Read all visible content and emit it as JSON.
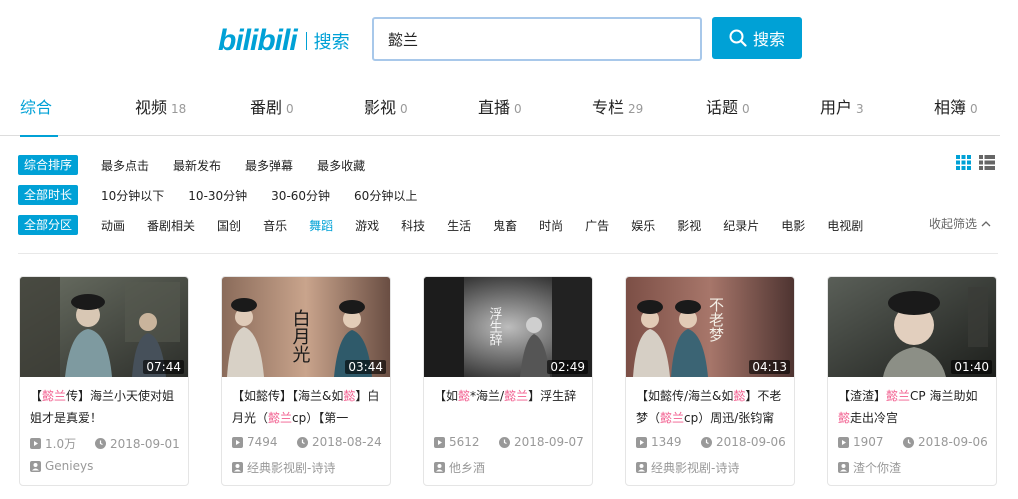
{
  "header": {
    "logo": "bilibili",
    "logo_sub": "搜索",
    "search_value": "懿兰",
    "search_button": "搜索"
  },
  "tabs": [
    {
      "label": "综合",
      "count": ""
    },
    {
      "label": "视频",
      "count": "18"
    },
    {
      "label": "番剧",
      "count": "0"
    },
    {
      "label": "影视",
      "count": "0"
    },
    {
      "label": "直播",
      "count": "0"
    },
    {
      "label": "专栏",
      "count": "29"
    },
    {
      "label": "话题",
      "count": "0"
    },
    {
      "label": "用户",
      "count": "3"
    },
    {
      "label": "相簿",
      "count": "0"
    }
  ],
  "filters": {
    "order": {
      "label": "综合排序",
      "items": [
        "最多点击",
        "最新发布",
        "最多弹幕",
        "最多收藏"
      ]
    },
    "duration": {
      "label": "全部时长",
      "items": [
        "10分钟以下",
        "10-30分钟",
        "30-60分钟",
        "60分钟以上"
      ]
    },
    "zone": {
      "label": "全部分区",
      "items": [
        "动画",
        "番剧相关",
        "国创",
        "音乐",
        "舞蹈",
        "游戏",
        "科技",
        "生活",
        "鬼畜",
        "时尚",
        "广告",
        "娱乐",
        "影视",
        "纪录片",
        "电影",
        "电视剧"
      ]
    },
    "collapse": "收起筛选"
  },
  "videos": [
    {
      "duration": "07:44",
      "title_parts": [
        "【",
        "懿兰",
        "传】海兰小天使对姐姐才是真爱！"
      ],
      "plays": "1.0万",
      "date": "2018-09-01",
      "uploader": "Genieys"
    },
    {
      "duration": "03:44",
      "title_parts": [
        "【如懿传】【海兰&如",
        "懿",
        "】白月光（",
        "懿兰",
        "cp）【第一"
      ],
      "plays": "7494",
      "date": "2018-08-24",
      "uploader": "经典影视剧-诗诗"
    },
    {
      "duration": "02:49",
      "title_parts": [
        "【如",
        "懿",
        "*海兰/",
        "懿兰",
        "】浮生辞"
      ],
      "plays": "5612",
      "date": "2018-09-07",
      "uploader": "他乡酒"
    },
    {
      "duration": "04:13",
      "title_parts": [
        "【如懿传/海兰&如",
        "懿",
        "】不老梦（",
        "懿兰",
        "cp）周迅/张钧甯"
      ],
      "plays": "1349",
      "date": "2018-09-06",
      "uploader": "经典影视剧-诗诗"
    },
    {
      "duration": "01:40",
      "title_parts": [
        "【渣渣】",
        "懿兰",
        "CP 海兰助如",
        "懿",
        "走出冷宫"
      ],
      "plays": "1907",
      "date": "2018-09-06",
      "uploader": "渣个你渣"
    }
  ],
  "thumb_text": [
    "白月光",
    "浮生辞",
    "不老梦"
  ]
}
